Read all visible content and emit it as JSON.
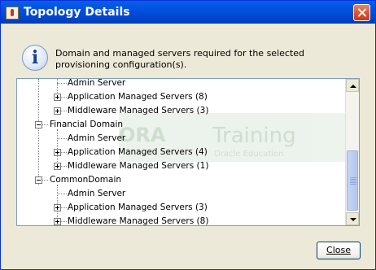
{
  "window": {
    "title": "Topology Details"
  },
  "message": "Domain and managed servers required for the selected provisioning configuration(s).",
  "watermark": {
    "part1": "ORA",
    "part2": "Training",
    "part3": "Oracle Education"
  },
  "tree": {
    "rows": [
      {
        "label": "Admin Server"
      },
      {
        "label": "Application Managed Servers (8)"
      },
      {
        "label": "Middleware Managed Servers (3)"
      },
      {
        "label": "Financial Domain"
      },
      {
        "label": "Admin Server"
      },
      {
        "label": "Application Managed Servers (4)"
      },
      {
        "label": "Middleware Managed Servers (1)"
      },
      {
        "label": "CommonDomain"
      },
      {
        "label": "Admin Server"
      },
      {
        "label": "Application Managed Servers (3)"
      },
      {
        "label": "Middleware Managed Servers (8)"
      }
    ]
  },
  "buttons": {
    "close_label": "Close"
  },
  "colors": {
    "titlebar": "#0054e3",
    "close_accent": "#d54f2d",
    "window_bg": "#ece9d8"
  }
}
